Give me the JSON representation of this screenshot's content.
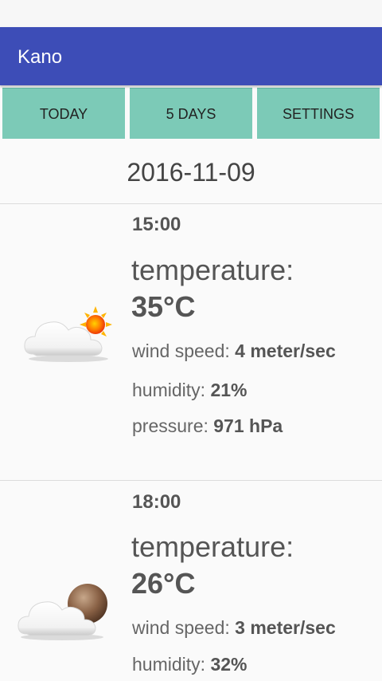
{
  "app": {
    "title": "Kano",
    "colors": {
      "app_bar": "#3d4db7",
      "tab_bg": "#7ccab7",
      "text": "#555555"
    }
  },
  "tabs": [
    {
      "label": "TODAY"
    },
    {
      "label": "5 DAYS"
    },
    {
      "label": "SETTINGS"
    }
  ],
  "date": "2016-11-09",
  "forecast": [
    {
      "time": "15:00",
      "icon": "cloud-sun-icon",
      "temperature_label": "temperature:",
      "temperature": "35°C",
      "wind_label": "wind speed:",
      "wind": "4 meter/sec",
      "humidity_label": "humidity:",
      "humidity": "21%",
      "pressure_label": "pressure:",
      "pressure": "971 hPa"
    },
    {
      "time": "18:00",
      "icon": "cloud-moon-icon",
      "temperature_label": "temperature:",
      "temperature": "26°C",
      "wind_label": "wind speed:",
      "wind": "3 meter/sec",
      "humidity_label": "humidity:",
      "humidity": "32%"
    }
  ]
}
